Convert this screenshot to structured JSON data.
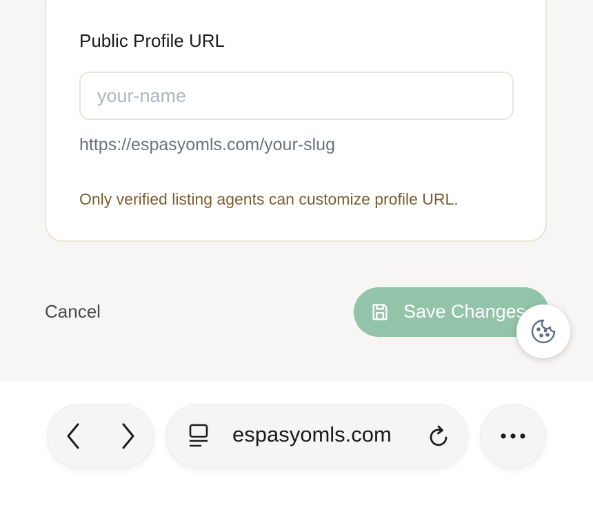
{
  "form": {
    "field_label": "Public Profile URL",
    "input_value": "",
    "input_placeholder": "your-name",
    "url_preview": "https://espasyomls.com/your-slug",
    "notice": "Only verified listing agents can customize profile URL."
  },
  "actions": {
    "cancel_label": "Cancel",
    "save_label": "Save Changes",
    "save_icon": "floppy-disk-icon",
    "save_color": "#93c3a9",
    "cookie_icon": "cookie-icon"
  },
  "browser": {
    "domain": "espasyomls.com",
    "back_icon": "chevron-left-icon",
    "forward_icon": "chevron-right-icon",
    "page_icon": "page-menu-icon",
    "reload_icon": "reload-icon",
    "more_icon": "more-icon"
  },
  "colors": {
    "notice": "#7a5d30",
    "link": "#6b7180"
  }
}
